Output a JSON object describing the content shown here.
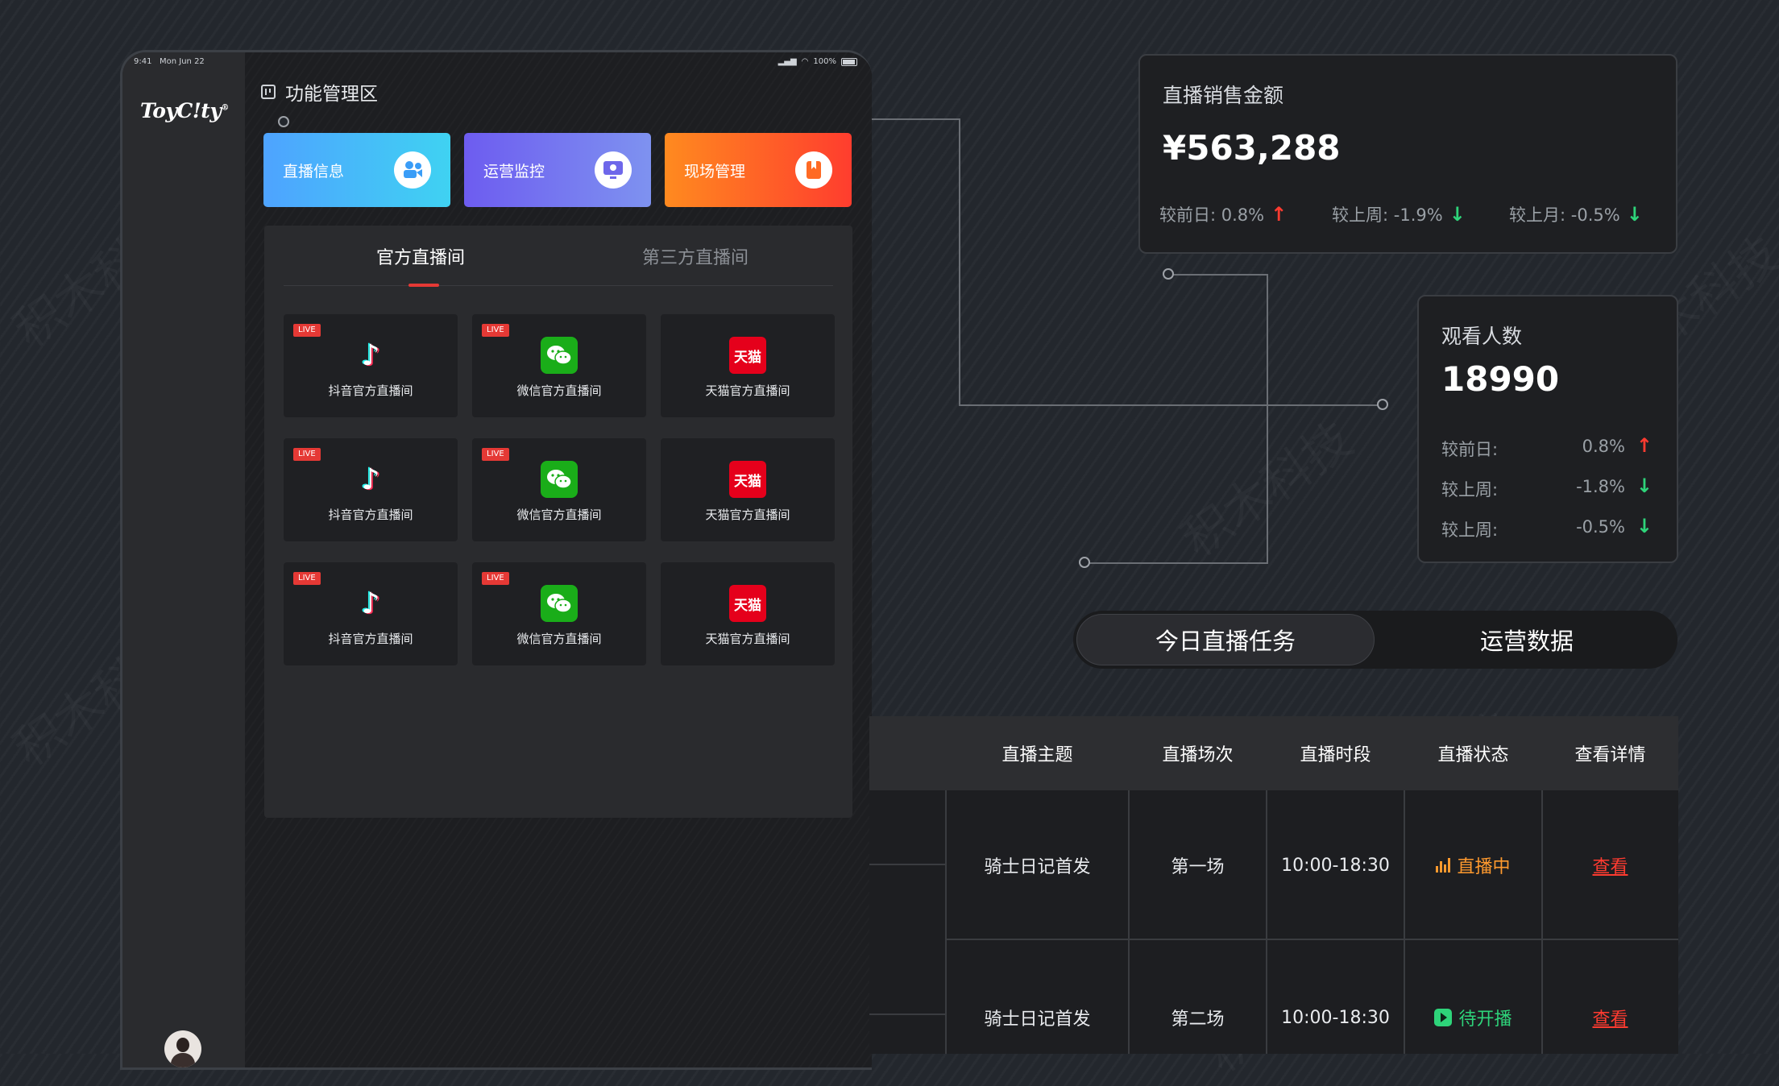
{
  "statusbar": {
    "time": "9:41",
    "date": "Mon Jun 22",
    "battery": "100%"
  },
  "brand": {
    "name": "ToyC!ty",
    "mark": "®"
  },
  "function_area": {
    "title": "功能管理区",
    "buttons": [
      {
        "label": "直播信息",
        "icon": "camera-user-icon"
      },
      {
        "label": "运营监控",
        "icon": "monitor-icon"
      },
      {
        "label": "现场管理",
        "icon": "bookmark-icon"
      }
    ]
  },
  "rooms": {
    "tabs": [
      {
        "label": "官方直播间",
        "active": true
      },
      {
        "label": "第三方直播间",
        "active": false
      }
    ],
    "live_badge": "LIVE",
    "cards": [
      {
        "platform": "douyin",
        "label": "抖音官方直播间",
        "live": true
      },
      {
        "platform": "wechat",
        "label": "微信官方直播间",
        "live": true
      },
      {
        "platform": "tmall",
        "label": "天猫官方直播间",
        "live": false,
        "logo_text": "天猫"
      },
      {
        "platform": "douyin",
        "label": "抖音官方直播间",
        "live": true
      },
      {
        "platform": "wechat",
        "label": "微信官方直播间",
        "live": true
      },
      {
        "platform": "tmall",
        "label": "天猫官方直播间",
        "live": false,
        "logo_text": "天猫"
      },
      {
        "platform": "douyin",
        "label": "抖音官方直播间",
        "live": true
      },
      {
        "platform": "wechat",
        "label": "微信官方直播间",
        "live": true
      },
      {
        "platform": "tmall",
        "label": "天猫官方直播间",
        "live": false,
        "logo_text": "天猫"
      }
    ]
  },
  "sales": {
    "title": "直播销售金额",
    "value": "¥563,288",
    "comparisons": [
      {
        "label": "较前日: 0.8%",
        "trend": "up"
      },
      {
        "label": "较上周: -1.9%",
        "trend": "down"
      },
      {
        "label": "较上月: -0.5%",
        "trend": "down"
      }
    ]
  },
  "viewers": {
    "title": "观看人数",
    "value": "18990",
    "comparisons": [
      {
        "label": "较前日:",
        "value": "0.8%",
        "trend": "up"
      },
      {
        "label": "较上周:",
        "value": "-1.8%",
        "trend": "down"
      },
      {
        "label": "较上周:",
        "value": "-0.5%",
        "trend": "down"
      }
    ]
  },
  "segment": {
    "active": "今日直播任务",
    "inactive": "运营数据"
  },
  "table": {
    "headers": [
      "直播主题",
      "直播场次",
      "直播时段",
      "直播状态",
      "查看详情"
    ],
    "rows": [
      {
        "topic": "骑士日记首发",
        "session": "第一场",
        "time": "10:00-18:30",
        "status": "直播中",
        "status_type": "live",
        "action": "查看"
      },
      {
        "topic": "骑士日记首发",
        "session": "第二场",
        "time": "10:00-18:30",
        "status": "待开播",
        "status_type": "pending",
        "action": "查看"
      }
    ]
  },
  "colors": {
    "accent_red": "#e53935",
    "up": "#ff3b30",
    "down": "#2ed47a",
    "live_status": "#ff9a2e",
    "pending_status": "#2ed47a"
  }
}
